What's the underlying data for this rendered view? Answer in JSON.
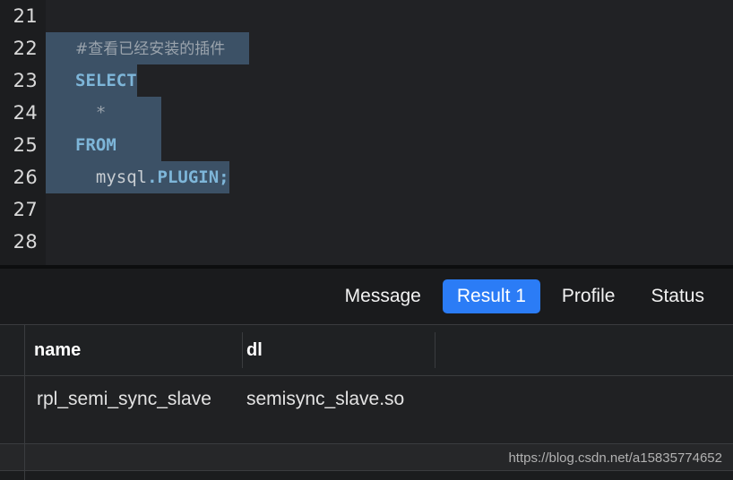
{
  "editor": {
    "line_numbers": [
      "21",
      "22",
      "23",
      "24",
      "25",
      "26",
      "27",
      "28"
    ],
    "lines": [
      {
        "number": "21",
        "text": "",
        "selected": false,
        "tokens": []
      },
      {
        "number": "22",
        "text": "#查看已经安装的插件",
        "selected": true,
        "tokens": [
          {
            "type": "comment",
            "text": "#查看已经安装的插件"
          }
        ]
      },
      {
        "number": "23",
        "text": "SELECT",
        "selected": true,
        "tokens": [
          {
            "type": "keyword",
            "text": "SELECT"
          }
        ]
      },
      {
        "number": "24",
        "text": "  *",
        "selected": true,
        "tokens": [
          {
            "type": "operator",
            "text": "  *"
          }
        ]
      },
      {
        "number": "25",
        "text": "FROM",
        "selected": true,
        "tokens": [
          {
            "type": "keyword",
            "text": "FROM"
          }
        ]
      },
      {
        "number": "26",
        "text": "  mysql.PLUGIN;",
        "selected": true,
        "tokens": [
          {
            "type": "plain",
            "text": "  mysql"
          },
          {
            "type": "keyword",
            "text": ".PLUGIN;"
          }
        ]
      },
      {
        "number": "27",
        "text": "",
        "selected": false,
        "tokens": []
      },
      {
        "number": "28",
        "text": "",
        "selected": false,
        "tokens": []
      }
    ],
    "comment_text": "#查看已经安装的插件",
    "select_keyword": "SELECT",
    "star": "  *",
    "from_keyword": "FROM",
    "table_schema": "  mysql",
    "table_name": ".PLUGIN;",
    "selection_color": "#3c5166",
    "keyword_color": "#7eb6d9",
    "comment_color": "#9aa3ac",
    "background": "#212225",
    "gutter_background": "#1c1d1f"
  },
  "results_panel": {
    "tabs": [
      {
        "label": "Message",
        "active": false
      },
      {
        "label": "Result 1",
        "active": true
      },
      {
        "label": "Profile",
        "active": false
      },
      {
        "label": "Status",
        "active": false
      }
    ],
    "active_tab_color": "#2b7cf6",
    "grid": {
      "columns": [
        "name",
        "dl"
      ],
      "rows": [
        [
          "rpl_semi_sync_slave",
          "semisync_slave.so"
        ]
      ]
    }
  },
  "watermark": {
    "text": "https://blog.csdn.net/a15835774652"
  }
}
